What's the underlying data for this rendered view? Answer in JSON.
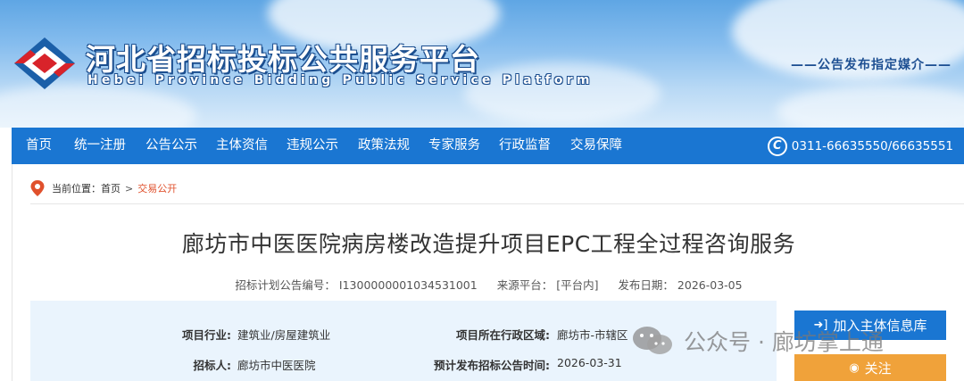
{
  "header": {
    "title": "河北省招标投标公共服务平台",
    "subtitle": "Hebei Province Bidding Public Service Platform",
    "slogan": "——公告发布指定媒介——"
  },
  "nav": {
    "items": [
      {
        "label": "首页"
      },
      {
        "label": "统一注册"
      },
      {
        "label": "公告公示"
      },
      {
        "label": "主体资信"
      },
      {
        "label": "违规公示"
      },
      {
        "label": "政策法规"
      },
      {
        "label": "专家服务"
      },
      {
        "label": "行政监督"
      },
      {
        "label": "交易保障"
      }
    ],
    "phone": "0311-66635550/66635551",
    "phone_icon": "phone-icon"
  },
  "breadcrumb": {
    "prefix": "当前位置：",
    "home": "首页",
    "separator": ">",
    "current": "交易公开"
  },
  "notice": {
    "title": "廊坊市中医医院病房楼改造提升项目EPC工程全过程咨询服务",
    "code_label": "招标计划公告编号：",
    "code_value": "I1300000001034531001",
    "source_label": "来源平台：",
    "source_value": "[平台内]",
    "date_label": "发布日期：",
    "date_value": "2026-03-05"
  },
  "info": {
    "industry_label": "项目行业:",
    "industry_value": "建筑业/房屋建筑业",
    "region_label": "项目所在行政区域:",
    "region_value": "廊坊市-市辖区",
    "tenderer_label": "招标人:",
    "tenderer_value": "廊坊市中医医院",
    "plan_time_label": "预计发布招标公告时间:",
    "plan_time_value": "2026-03-31"
  },
  "actions": {
    "join_label": "加入主体信息库",
    "follow_label": "关注"
  },
  "watermark": {
    "text": "公众号 · 廊坊掌上通"
  },
  "colors": {
    "nav_blue": "#1a76d2",
    "accent_orange": "#f0a23a",
    "breadcrumb_current": "#e0502c",
    "panel_bg": "#eaf4fd"
  }
}
